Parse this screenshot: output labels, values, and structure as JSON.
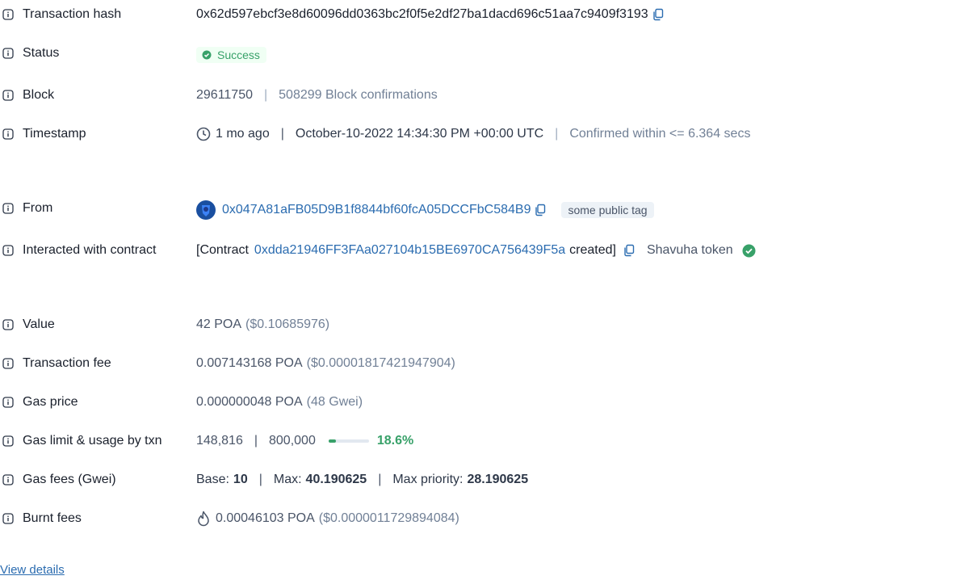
{
  "labels": {
    "tx_hash": "Transaction hash",
    "status": "Status",
    "block": "Block",
    "timestamp": "Timestamp",
    "from": "From",
    "contract": "Interacted with contract",
    "value": "Value",
    "fee": "Transaction fee",
    "gas_price": "Gas price",
    "gas_limit": "Gas limit & usage by txn",
    "gas_fees": "Gas fees (Gwei)",
    "burnt": "Burnt fees"
  },
  "tx": {
    "hash": "0x62d597ebcf3e8d60096dd0363bc2f0f5e2df27ba1dacd696c51aa7c9409f3193",
    "status": "Success",
    "block_number": "29611750",
    "block_confirmations": "508299 Block confirmations",
    "time_ago": "1 mo ago",
    "timestamp": "October-10-2022 14:34:30 PM +00:00 UTC",
    "confirmed_within": "Confirmed within <= 6.364 secs",
    "from_address": "0x047A81aFB05D9B1f8844bf60fcA05DCCFbC584B9",
    "from_tag": "some public tag",
    "contract_prefix": "[Contract",
    "contract_address": "0xdda21946FF3FAa027104b15BE6970CA756439F5a",
    "contract_suffix": "created]",
    "token_name": "Shavuha token",
    "value_amount": "42 POA",
    "value_usd": "($0.10685976)",
    "fee_amount": "0.007143168 POA",
    "fee_usd": "($0.00001817421947904)",
    "gas_price_amount": "0.000000048 POA",
    "gas_price_gwei": "(48 Gwei)",
    "gas_used": "148,816",
    "gas_limit": "800,000",
    "gas_usage_pct": "18.6%",
    "gas_usage_fraction": 0.186,
    "base_label": "Base:",
    "base_value": "10",
    "max_label": "Max:",
    "max_value": "40.190625",
    "priority_label": "Max priority:",
    "priority_value": "28.190625",
    "burnt_amount": "0.00046103 POA",
    "burnt_usd": "($0.0000011729894084)"
  },
  "footer": {
    "view_details": "View details"
  },
  "colors": {
    "accent": "#2b6cb0",
    "success": "#38a169",
    "muted": "#718096"
  },
  "icons": [
    "info-icon",
    "copy-icon",
    "check-circle-icon",
    "clock-icon",
    "flame-icon",
    "avatar-icon",
    "verified-icon"
  ]
}
